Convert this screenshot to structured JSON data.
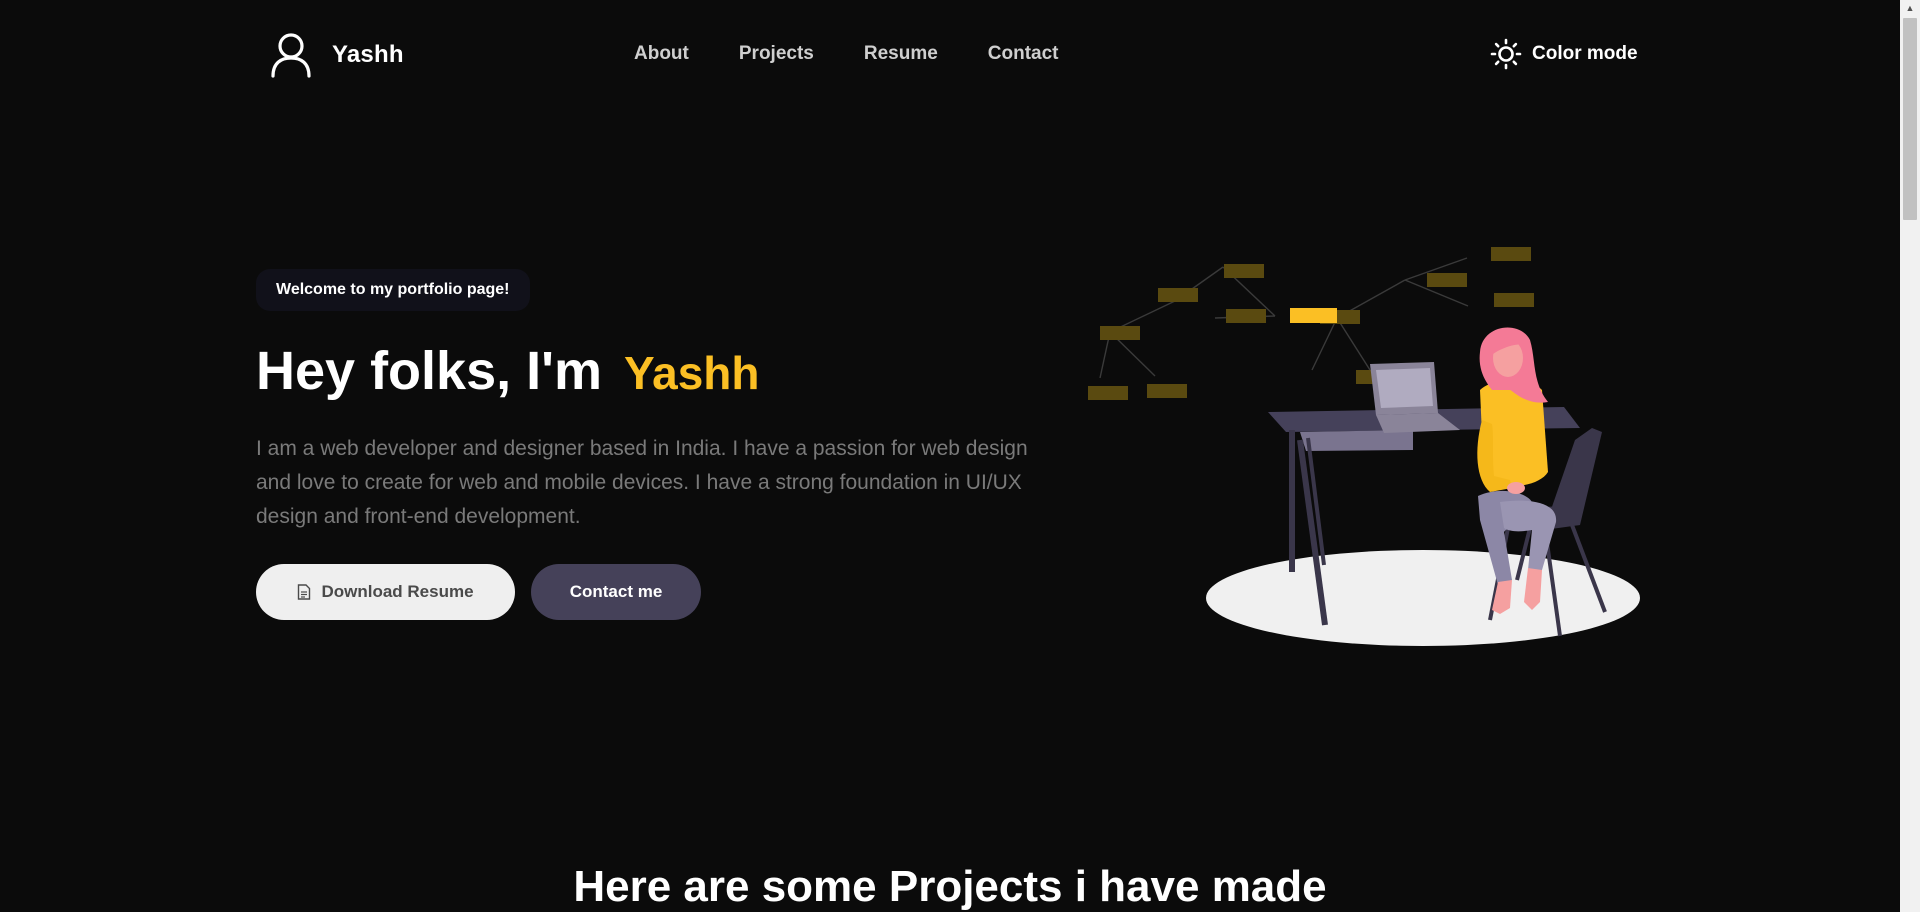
{
  "header": {
    "brand_name": "Yashh",
    "nav": [
      {
        "label": "About"
      },
      {
        "label": "Projects"
      },
      {
        "label": "Resume"
      },
      {
        "label": "Contact"
      }
    ],
    "color_mode_label": "Color mode"
  },
  "hero": {
    "badge": "Welcome to my portfolio page!",
    "title_prefix": "Hey folks, I'm",
    "title_name": "Yashh",
    "description": "I am a web developer and designer based in India. I have a passion for web design and love to create for web and mobile devices. I have a strong foundation in UI/UX design and front-end development.",
    "download_button": "Download Resume",
    "contact_button": "Contact me"
  },
  "projects": {
    "title": "Here are some Projects i have made"
  },
  "colors": {
    "background": "#0b0b0b",
    "accent": "#fbbf24",
    "button_dark": "#454159",
    "button_light": "#efefef",
    "muted_text": "#7a7a7a"
  },
  "icons": {
    "brand": "user-icon",
    "color_mode": "sun-icon",
    "download": "document-icon"
  }
}
